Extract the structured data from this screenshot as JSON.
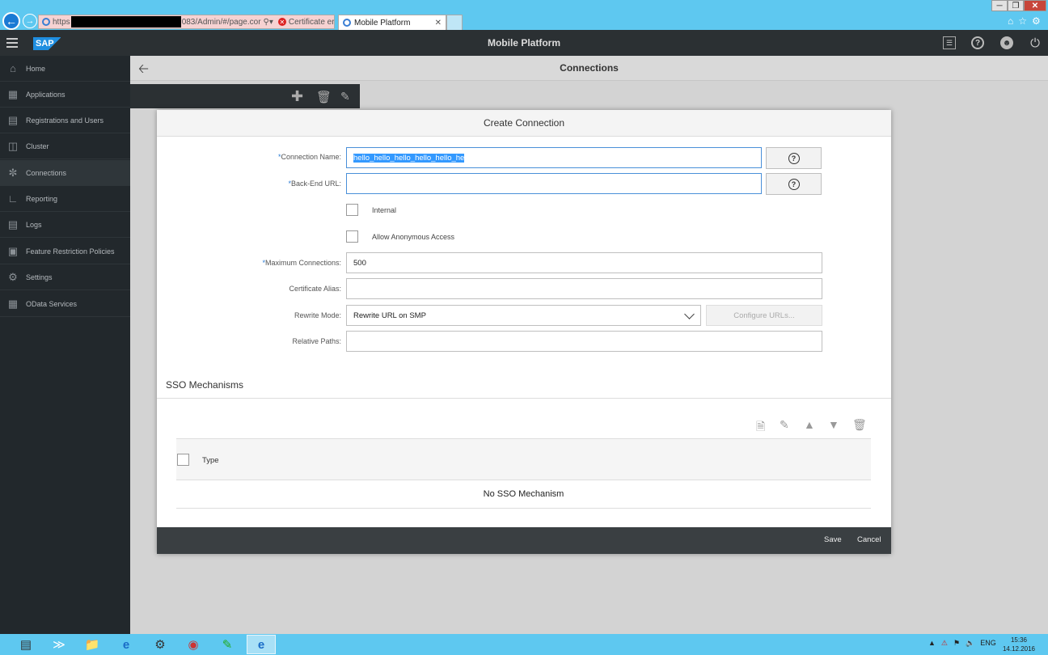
{
  "browser": {
    "address_prefix": "https",
    "address_suffix": "083/Admin/#/page.cor",
    "certificate_error": "Certificate error",
    "tab_title": "Mobile Platform"
  },
  "header": {
    "logo": "SAP",
    "title": "Mobile Platform"
  },
  "sidebar": {
    "items": [
      {
        "label": "Home",
        "icon": "home-icon"
      },
      {
        "label": "Applications",
        "icon": "applications-icon"
      },
      {
        "label": "Registrations and Users",
        "icon": "registrations-icon"
      },
      {
        "label": "Cluster",
        "icon": "cluster-icon"
      },
      {
        "label": "Connections",
        "icon": "connections-icon",
        "active": true
      },
      {
        "label": "Reporting",
        "icon": "reporting-icon"
      },
      {
        "label": "Logs",
        "icon": "logs-icon"
      },
      {
        "label": "Feature Restriction Policies",
        "icon": "policy-icon"
      },
      {
        "label": "Settings",
        "icon": "settings-icon"
      },
      {
        "label": "OData Services",
        "icon": "odata-icon"
      }
    ]
  },
  "page": {
    "title": "Connections"
  },
  "dialog": {
    "title": "Create Connection",
    "required_mark": "*",
    "connection_name": {
      "label": "Connection Name:",
      "value": "hello_hello_hello_hello_hello_he"
    },
    "backend_url": {
      "label": "Back-End URL:",
      "value": ""
    },
    "internal": {
      "label": "Internal",
      "checked": false
    },
    "anonymous": {
      "label": "Allow Anonymous Access",
      "checked": false
    },
    "max_connections": {
      "label": "Maximum Connections:",
      "value": "500"
    },
    "certificate_alias": {
      "label": "Certificate Alias:",
      "value": ""
    },
    "rewrite_mode": {
      "label": "Rewrite Mode:",
      "value": "Rewrite URL on SMP"
    },
    "configure_urls": "Configure URLs...",
    "relative_paths": {
      "label": "Relative Paths:",
      "value": ""
    },
    "help": "?",
    "sso": {
      "title": "SSO Mechanisms",
      "column_type": "Type",
      "empty_text": "No SSO Mechanism"
    },
    "save": "Save",
    "cancel": "Cancel"
  },
  "taskbar": {
    "lang": "ENG",
    "time": "15:36",
    "date": "14.12.2016"
  },
  "colors": {
    "accent": "#3399ff",
    "sidebar_bg": "#22282c",
    "header_bg": "#2b3033",
    "taskbar": "#5ec8f0"
  }
}
